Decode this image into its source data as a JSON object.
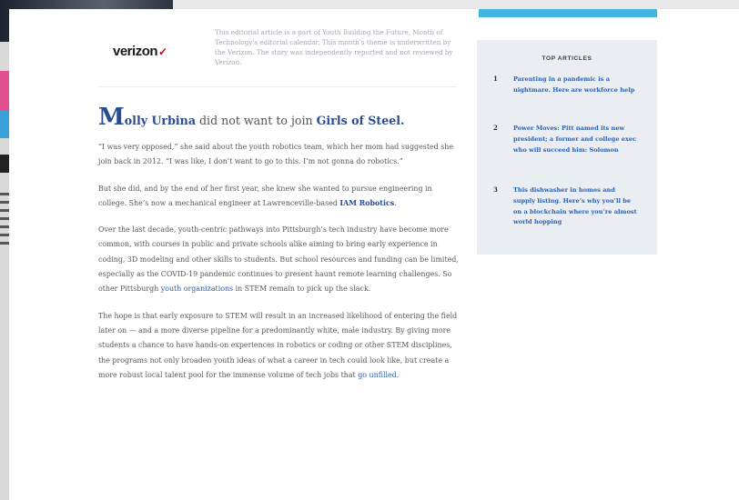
{
  "sponsor": {
    "logo": "verizon",
    "logo_mark": "✓",
    "note": "This editorial article is a part of Youth Building the Future, Month of Technology's editorial calendar. This month's theme is underwritten by the Verizon. The story was independently reported and not reviewed by Verizon."
  },
  "article": {
    "dropcap": "M",
    "lede_name": "olly Urbina",
    "lede_mid": " did not want to join ",
    "lede_org": "Girls of Steel.",
    "p1": "“I was very opposed,” she said about the youth robotics team, which her mom had suggested she join back in 2012. “I was like, I don’t want to go to this. I’m not gonna do robotics.”",
    "p2_pre": "But she did, and by the end of her first year, she knew she wanted to pursue engineering in college. She’s now a mechanical engineer at Lawrenceville-based ",
    "p2_link": "IAM Robotics",
    "p2_post": ".",
    "p3_pre": "Over the last decade, youth-centric pathways into Pittsburgh’s tech industry have become more common, with courses in public and private schools alike aiming to bring early experience in coding, 3D modeling and other skills to students. But school resources and funding can be limited, especially as the COVID-19 pandemic continues to present haunt remote learning challenges. So other Pittsburgh ",
    "p3_link": "youth organizations",
    "p3_post": " in STEM remain to pick up the slack.",
    "p4_pre": "The hope is that early exposure to STEM will result in an increased likelihood of entering the field later on — and a more diverse pipeline for a predominantly white, male industry. By giving more students a chance to have hands-on experiences in robotics or coding or other STEM disciplines, the programs not only broaden youth ideas of what a career in tech could look like, but create a more robust local talent pool for the immense volume of tech jobs that ",
    "p4_link": "go unfilled",
    "p4_post": "."
  },
  "sidebar": {
    "title": "TOP ARTICLES",
    "items": [
      {
        "num": "1",
        "text": "Parenting in a pandemic is a nightmare. Here are workforce help"
      },
      {
        "num": "2",
        "text": "Power Moves: Pitt named its new president; a former and college exec who will succeed him: Solomon"
      },
      {
        "num": "3",
        "text": "This dishwasher in homes and supply listing. Here’s why you’ll be on a blockchain where you’re almost world hopping"
      }
    ]
  },
  "colors": {
    "accent": "#2b4c8f",
    "link": "#2b5fb0",
    "ad_bar": "#41b6e0",
    "sidebar_bg": "#eaedf1"
  }
}
